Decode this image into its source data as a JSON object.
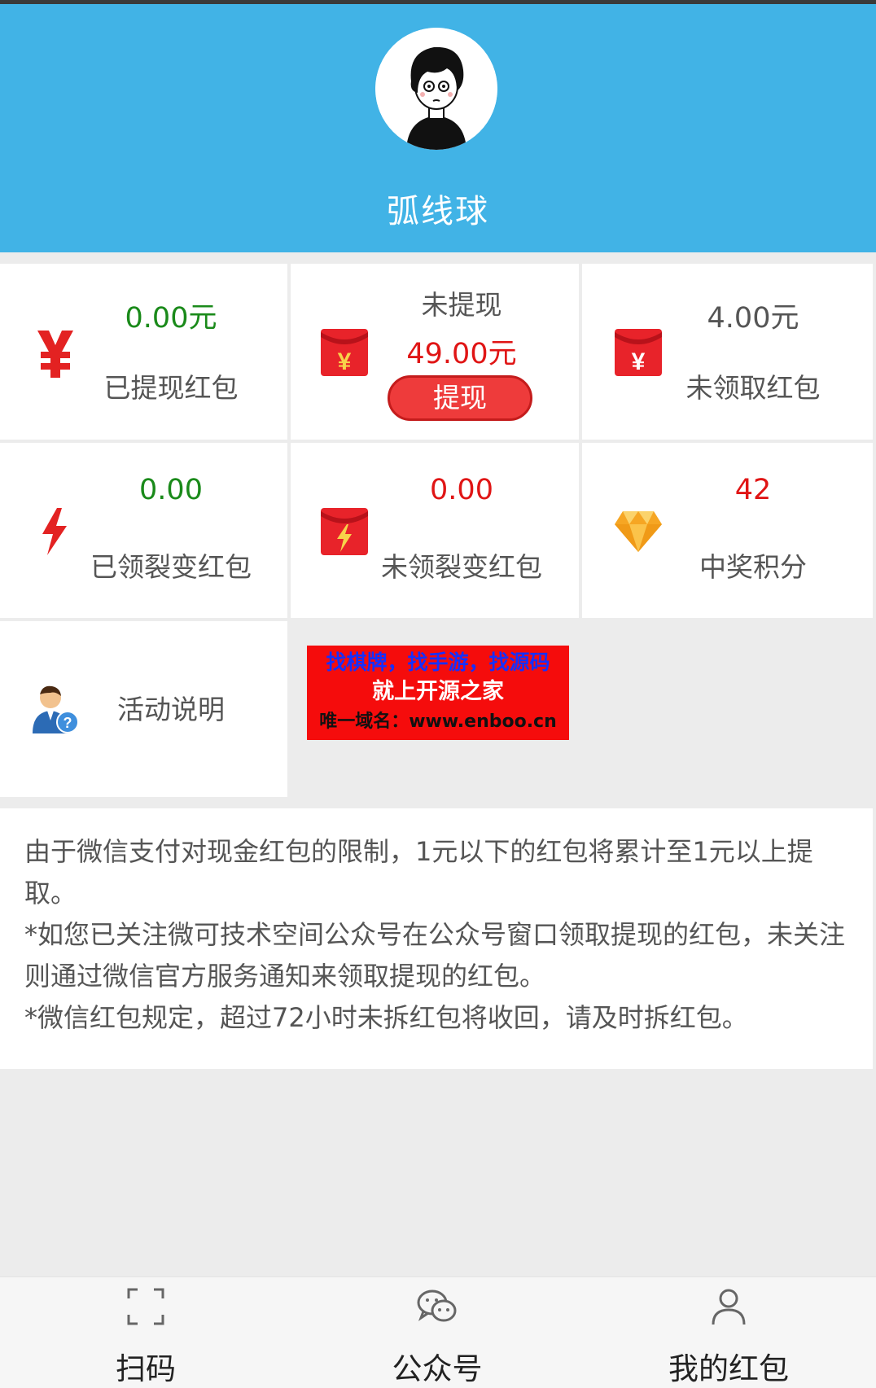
{
  "profile": {
    "username": "弧线球"
  },
  "stats": {
    "withdrawn": {
      "value": "0.00元",
      "label": "已提现红包"
    },
    "pending": {
      "title": "未提现",
      "value": "49.00元",
      "button": "提现"
    },
    "unclaimed": {
      "value": "4.00元",
      "label": "未领取红包"
    },
    "fission_claimed": {
      "value": "0.00",
      "label": "已领裂变红包"
    },
    "fission_unclaimed": {
      "value": "0.00",
      "label": "未领裂变红包"
    },
    "points": {
      "value": "42",
      "label": "中奖积分"
    }
  },
  "activity": {
    "label": "活动说明"
  },
  "ad": {
    "line1": "找棋牌，找手游，找源码",
    "line2": "就上开源之家",
    "line3": "唯一域名：www.enboo.cn"
  },
  "notice": {
    "paragraphs": [
      "由于微信支付对现金红包的限制，1元以下的红包将累计至1元以上提取。",
      "*如您已关注微可技术空间公众号在公众号窗口领取提现的红包，未关注则通过微信官方服务通知来领取提现的红包。",
      "*微信红包规定，超过72小时未拆红包将收回，请及时拆红包。"
    ]
  },
  "tabbar": {
    "items": [
      {
        "label": "扫码",
        "icon": "scan-icon"
      },
      {
        "label": "公众号",
        "icon": "wechat-icon"
      },
      {
        "label": "我的红包",
        "icon": "user-icon"
      }
    ]
  },
  "colors": {
    "header": "#41b3e6",
    "green_value": "#1a8a1a",
    "red_value": "#e01515",
    "button": "#ee3b3b"
  }
}
